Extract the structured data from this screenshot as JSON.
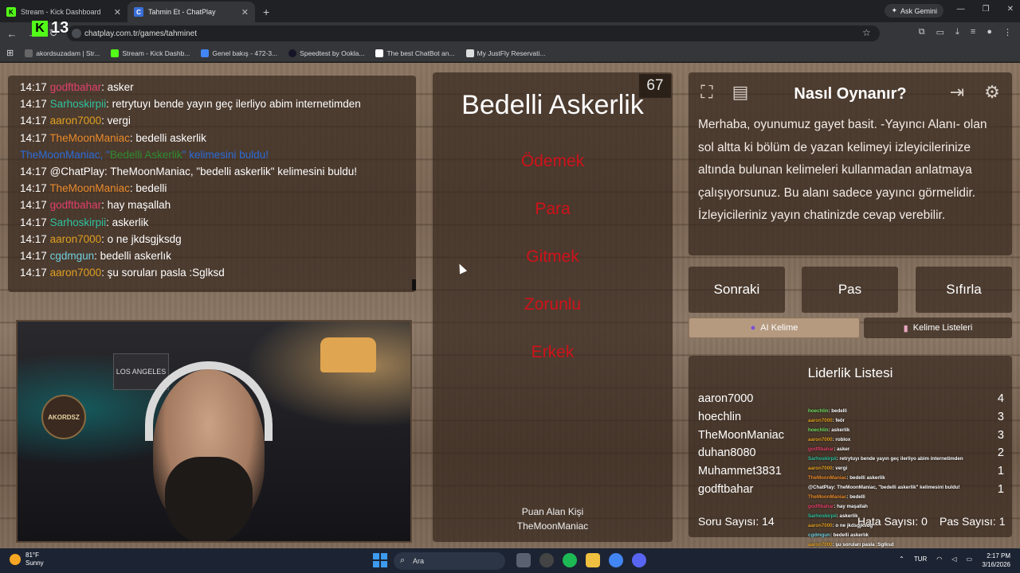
{
  "browser": {
    "tabs": [
      {
        "label": "Stream - Kick Dashboard",
        "active": false
      },
      {
        "label": "Tahmin Et - ChatPlay",
        "active": true
      }
    ],
    "new_tab": "+",
    "gemini": "Ask Gemini",
    "url": "chatplay.com.tr/games/tahminet",
    "bookmarks": [
      "akordsuzadam | Str...",
      "Stream - Kick Dashb...",
      "Genel bakış - 472-3...",
      "Speedtest by Ookla...",
      "The best ChatBot an...",
      "My JustFly Reservati..."
    ]
  },
  "kick_badge": {
    "letter": "K",
    "count": "13"
  },
  "chat": [
    {
      "time": "14:17",
      "user": "godftbahar",
      "color": "#e0406a",
      "msg": ": asker"
    },
    {
      "time": "14:17",
      "user": "Sarhoskirpii",
      "color": "#2fc3a0",
      "msg": ": retrytuyı bende yayın geç ilerliyo abim internetimden"
    },
    {
      "time": "14:17",
      "user": "aaron7000",
      "color": "#e0a020",
      "msg": ": vergi"
    },
    {
      "time": "14:17",
      "user": "TheMoonManiac",
      "color": "#e88a2a",
      "msg": ": bedelli askerlik"
    },
    {
      "system": true,
      "pre": "TheMoonManiac, \"",
      "word": "Bedelli Askerlik",
      "post": "\" kelimesini buldu!"
    },
    {
      "time": "14:17",
      "user": "@ChatPlay",
      "color": "#ffffff",
      "msg": ": TheMoonManiac, \"bedelli askerlik\" kelimesini buldu!"
    },
    {
      "time": "14:17",
      "user": "TheMoonManiac",
      "color": "#e88a2a",
      "msg": ": bedelli"
    },
    {
      "time": "14:17",
      "user": "godftbahar",
      "color": "#e0406a",
      "msg": ": hay maşallah"
    },
    {
      "time": "14:17",
      "user": "Sarhoskirpii",
      "color": "#2fc3a0",
      "msg": ": askerlik"
    },
    {
      "time": "14:17",
      "user": "aaron7000",
      "color": "#e0a020",
      "msg": ": o ne jkdsgjksdg"
    },
    {
      "time": "14:17",
      "user": "cgdmgun",
      "color": "#6fd0e0",
      "msg": ": bedelli askerlık"
    },
    {
      "time": "14:17",
      "user": "aaron7000",
      "color": "#e0a020",
      "msg": ": şu soruları pasla :Sglksd"
    }
  ],
  "webcam": {
    "sign_text": "AKORDSZ",
    "la_text": "LOS ANGELES"
  },
  "card": {
    "timer": "67",
    "target_word": "Bedelli Askerlik",
    "taboo_words": [
      "Ödemek",
      "Para",
      "Gitmek",
      "Zorunlu",
      "Erkek"
    ],
    "scorer_label": "Puan Alan Kişi",
    "scorer_name": "TheMoonManiac"
  },
  "howto": {
    "title": "Nasıl Oynanır?",
    "text": "Merhaba, oyunumuz gayet basit. -Yayıncı Alanı- olan sol altta ki bölüm de yazan kelimeyi izleyicilerinize altında bulunan kelimeleri kullanmadan anlatmaya çalışıyorsunuz. Bu alanı sadece yayıncı görmelidir. İzleyicileriniz yayın chatinizde cevap verebilir."
  },
  "actions": {
    "next": "Sonraki",
    "pass": "Pas",
    "reset": "Sıfırla"
  },
  "word_sources": {
    "ai": "AI Kelime",
    "lists": "Kelime Listeleri"
  },
  "leaderboard": {
    "title": "Liderlik Listesi",
    "rows": [
      {
        "name": "aaron7000",
        "score": "4"
      },
      {
        "name": "hoechlin",
        "score": "3"
      },
      {
        "name": "TheMoonManiac",
        "score": "3"
      },
      {
        "name": "duhan8080",
        "score": "2"
      },
      {
        "name": "Muhammet3831",
        "score": "1"
      },
      {
        "name": "godftbahar",
        "score": "1"
      }
    ],
    "question_count": "Soru Sayısı: 14",
    "error_count": "Hata Sayısı: 0",
    "pass_count": "Pas Sayısı: 1"
  },
  "overlay_chat": [
    {
      "user": "hoechlin",
      "color": "#6fe060",
      "msg": ": bedelli"
    },
    {
      "user": "aaron7000",
      "color": "#e0a020",
      "msg": ": feör"
    },
    {
      "user": "hoechlin",
      "color": "#6fe060",
      "msg": ": askerlik"
    },
    {
      "user": "aaron7000",
      "color": "#e0a020",
      "msg": ": roblox"
    },
    {
      "user": "godftbahar",
      "color": "#e0406a",
      "msg": ": asker"
    },
    {
      "user": "Sarhoskirpii",
      "color": "#2fc3a0",
      "msg": ": retrytuyı bende yayın geç ilerliyo abim internetimden"
    },
    {
      "user": "aaron7000",
      "color": "#e0a020",
      "msg": ": vergi"
    },
    {
      "user": "TheMoonManiac",
      "color": "#e88a2a",
      "msg": ": bedelli askerlik"
    },
    {
      "user": "@ChatPlay",
      "color": "#ffffff",
      "msg": ": TheMoonManiac, \"bedelli askerlik\" kelimesini buldu!"
    },
    {
      "user": "TheMoonManiac",
      "color": "#e88a2a",
      "msg": ": bedelli"
    },
    {
      "user": "godftbahar",
      "color": "#e0406a",
      "msg": ": hay maşallah"
    },
    {
      "user": "Sarhoskirpii",
      "color": "#2fc3a0",
      "msg": ": askerlik"
    },
    {
      "user": "aaron7000",
      "color": "#e0a020",
      "msg": ": o ne jkdsgjksdg"
    },
    {
      "user": "cgdmgun",
      "color": "#6fd0e0",
      "msg": ": bedelli askerlık"
    },
    {
      "user": "aaron7000",
      "color": "#e0a020",
      "msg": ": şu soruları pasla :Sglksd"
    }
  ],
  "taskbar": {
    "temp": "81°F",
    "condition": "Sunny",
    "search_placeholder": "Ara",
    "lang": "TUR",
    "time": "2:17 PM",
    "date": "3/16/2026"
  }
}
